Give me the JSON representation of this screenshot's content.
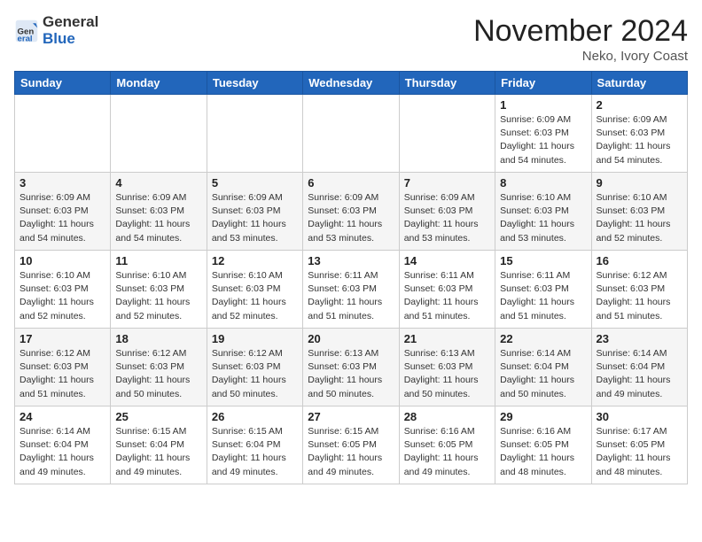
{
  "header": {
    "logo_general": "General",
    "logo_blue": "Blue",
    "month_title": "November 2024",
    "location": "Neko, Ivory Coast"
  },
  "days_of_week": [
    "Sunday",
    "Monday",
    "Tuesday",
    "Wednesday",
    "Thursday",
    "Friday",
    "Saturday"
  ],
  "weeks": [
    [
      {
        "day": "",
        "info": ""
      },
      {
        "day": "",
        "info": ""
      },
      {
        "day": "",
        "info": ""
      },
      {
        "day": "",
        "info": ""
      },
      {
        "day": "",
        "info": ""
      },
      {
        "day": "1",
        "info": "Sunrise: 6:09 AM\nSunset: 6:03 PM\nDaylight: 11 hours\nand 54 minutes."
      },
      {
        "day": "2",
        "info": "Sunrise: 6:09 AM\nSunset: 6:03 PM\nDaylight: 11 hours\nand 54 minutes."
      }
    ],
    [
      {
        "day": "3",
        "info": "Sunrise: 6:09 AM\nSunset: 6:03 PM\nDaylight: 11 hours\nand 54 minutes."
      },
      {
        "day": "4",
        "info": "Sunrise: 6:09 AM\nSunset: 6:03 PM\nDaylight: 11 hours\nand 54 minutes."
      },
      {
        "day": "5",
        "info": "Sunrise: 6:09 AM\nSunset: 6:03 PM\nDaylight: 11 hours\nand 53 minutes."
      },
      {
        "day": "6",
        "info": "Sunrise: 6:09 AM\nSunset: 6:03 PM\nDaylight: 11 hours\nand 53 minutes."
      },
      {
        "day": "7",
        "info": "Sunrise: 6:09 AM\nSunset: 6:03 PM\nDaylight: 11 hours\nand 53 minutes."
      },
      {
        "day": "8",
        "info": "Sunrise: 6:10 AM\nSunset: 6:03 PM\nDaylight: 11 hours\nand 53 minutes."
      },
      {
        "day": "9",
        "info": "Sunrise: 6:10 AM\nSunset: 6:03 PM\nDaylight: 11 hours\nand 52 minutes."
      }
    ],
    [
      {
        "day": "10",
        "info": "Sunrise: 6:10 AM\nSunset: 6:03 PM\nDaylight: 11 hours\nand 52 minutes."
      },
      {
        "day": "11",
        "info": "Sunrise: 6:10 AM\nSunset: 6:03 PM\nDaylight: 11 hours\nand 52 minutes."
      },
      {
        "day": "12",
        "info": "Sunrise: 6:10 AM\nSunset: 6:03 PM\nDaylight: 11 hours\nand 52 minutes."
      },
      {
        "day": "13",
        "info": "Sunrise: 6:11 AM\nSunset: 6:03 PM\nDaylight: 11 hours\nand 51 minutes."
      },
      {
        "day": "14",
        "info": "Sunrise: 6:11 AM\nSunset: 6:03 PM\nDaylight: 11 hours\nand 51 minutes."
      },
      {
        "day": "15",
        "info": "Sunrise: 6:11 AM\nSunset: 6:03 PM\nDaylight: 11 hours\nand 51 minutes."
      },
      {
        "day": "16",
        "info": "Sunrise: 6:12 AM\nSunset: 6:03 PM\nDaylight: 11 hours\nand 51 minutes."
      }
    ],
    [
      {
        "day": "17",
        "info": "Sunrise: 6:12 AM\nSunset: 6:03 PM\nDaylight: 11 hours\nand 51 minutes."
      },
      {
        "day": "18",
        "info": "Sunrise: 6:12 AM\nSunset: 6:03 PM\nDaylight: 11 hours\nand 50 minutes."
      },
      {
        "day": "19",
        "info": "Sunrise: 6:12 AM\nSunset: 6:03 PM\nDaylight: 11 hours\nand 50 minutes."
      },
      {
        "day": "20",
        "info": "Sunrise: 6:13 AM\nSunset: 6:03 PM\nDaylight: 11 hours\nand 50 minutes."
      },
      {
        "day": "21",
        "info": "Sunrise: 6:13 AM\nSunset: 6:03 PM\nDaylight: 11 hours\nand 50 minutes."
      },
      {
        "day": "22",
        "info": "Sunrise: 6:14 AM\nSunset: 6:04 PM\nDaylight: 11 hours\nand 50 minutes."
      },
      {
        "day": "23",
        "info": "Sunrise: 6:14 AM\nSunset: 6:04 PM\nDaylight: 11 hours\nand 49 minutes."
      }
    ],
    [
      {
        "day": "24",
        "info": "Sunrise: 6:14 AM\nSunset: 6:04 PM\nDaylight: 11 hours\nand 49 minutes."
      },
      {
        "day": "25",
        "info": "Sunrise: 6:15 AM\nSunset: 6:04 PM\nDaylight: 11 hours\nand 49 minutes."
      },
      {
        "day": "26",
        "info": "Sunrise: 6:15 AM\nSunset: 6:04 PM\nDaylight: 11 hours\nand 49 minutes."
      },
      {
        "day": "27",
        "info": "Sunrise: 6:15 AM\nSunset: 6:05 PM\nDaylight: 11 hours\nand 49 minutes."
      },
      {
        "day": "28",
        "info": "Sunrise: 6:16 AM\nSunset: 6:05 PM\nDaylight: 11 hours\nand 49 minutes."
      },
      {
        "day": "29",
        "info": "Sunrise: 6:16 AM\nSunset: 6:05 PM\nDaylight: 11 hours\nand 48 minutes."
      },
      {
        "day": "30",
        "info": "Sunrise: 6:17 AM\nSunset: 6:05 PM\nDaylight: 11 hours\nand 48 minutes."
      }
    ]
  ]
}
